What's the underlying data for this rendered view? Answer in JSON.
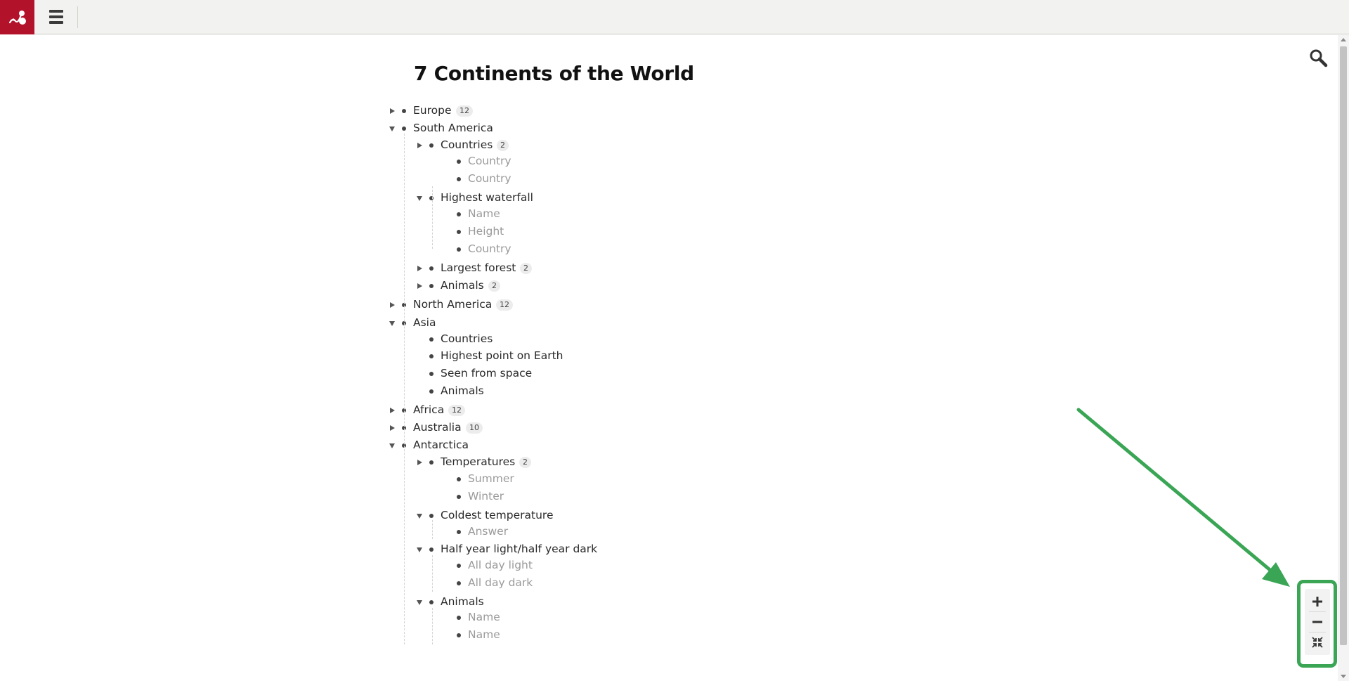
{
  "app": {
    "logo_icon": "app-logo-icon",
    "menu_icon": "hamburger-menu-icon",
    "search_icon": "search-icon"
  },
  "document": {
    "title": "7 Continents of the World"
  },
  "tree": [
    {
      "id": "europe",
      "depth": 0,
      "label": "Europe",
      "expander": "collapsed",
      "count": "12",
      "muted": false
    },
    {
      "id": "south-america",
      "depth": 0,
      "label": "South America",
      "expander": "expanded",
      "count": "",
      "muted": false
    },
    {
      "id": "sa-countries",
      "depth": 1,
      "label": "Countries",
      "expander": "collapsed",
      "count": "2",
      "muted": false
    },
    {
      "id": "sa-country-1",
      "depth": 2,
      "label": "Country",
      "expander": "none",
      "count": "",
      "muted": true
    },
    {
      "id": "sa-country-2",
      "depth": 2,
      "label": "Country",
      "expander": "none",
      "count": "",
      "muted": true
    },
    {
      "id": "sa-waterfall",
      "depth": 1,
      "label": "Highest waterfall",
      "expander": "expanded",
      "count": "",
      "muted": false
    },
    {
      "id": "sa-wf-name",
      "depth": 2,
      "label": "Name",
      "expander": "none",
      "count": "",
      "muted": true
    },
    {
      "id": "sa-wf-height",
      "depth": 2,
      "label": "Height",
      "expander": "none",
      "count": "",
      "muted": true
    },
    {
      "id": "sa-wf-country",
      "depth": 2,
      "label": "Country",
      "expander": "none",
      "count": "",
      "muted": true
    },
    {
      "id": "sa-forest",
      "depth": 1,
      "label": "Largest forest",
      "expander": "collapsed",
      "count": "2",
      "muted": false
    },
    {
      "id": "sa-animals",
      "depth": 1,
      "label": "Animals",
      "expander": "collapsed",
      "count": "2",
      "muted": false
    },
    {
      "id": "north-america",
      "depth": 0,
      "label": "North America",
      "expander": "collapsed",
      "count": "12",
      "muted": false
    },
    {
      "id": "asia",
      "depth": 0,
      "label": "Asia",
      "expander": "expanded",
      "count": "",
      "muted": false
    },
    {
      "id": "asia-countries",
      "depth": 1,
      "label": "Countries",
      "expander": "none",
      "count": "",
      "muted": false
    },
    {
      "id": "asia-highest",
      "depth": 1,
      "label": "Highest point on Earth",
      "expander": "none",
      "count": "",
      "muted": false
    },
    {
      "id": "asia-space",
      "depth": 1,
      "label": "Seen from space",
      "expander": "none",
      "count": "",
      "muted": false
    },
    {
      "id": "asia-animals",
      "depth": 1,
      "label": "Animals",
      "expander": "none",
      "count": "",
      "muted": false
    },
    {
      "id": "africa",
      "depth": 0,
      "label": "Africa",
      "expander": "collapsed",
      "count": "12",
      "muted": false
    },
    {
      "id": "australia",
      "depth": 0,
      "label": "Australia",
      "expander": "collapsed",
      "count": "10",
      "muted": false
    },
    {
      "id": "antarctica",
      "depth": 0,
      "label": "Antarctica",
      "expander": "expanded",
      "count": "",
      "muted": false
    },
    {
      "id": "ant-temps",
      "depth": 1,
      "label": "Temperatures",
      "expander": "collapsed",
      "count": "2",
      "muted": false
    },
    {
      "id": "ant-summer",
      "depth": 2,
      "label": "Summer",
      "expander": "none",
      "count": "",
      "muted": true
    },
    {
      "id": "ant-winter",
      "depth": 2,
      "label": "Winter",
      "expander": "none",
      "count": "",
      "muted": true
    },
    {
      "id": "ant-coldest",
      "depth": 1,
      "label": "Coldest temperature",
      "expander": "expanded",
      "count": "",
      "muted": false
    },
    {
      "id": "ant-answer",
      "depth": 2,
      "label": "Answer",
      "expander": "none",
      "count": "",
      "muted": true
    },
    {
      "id": "ant-halfyear",
      "depth": 1,
      "label": "Half year light/half year dark",
      "expander": "expanded",
      "count": "",
      "muted": false
    },
    {
      "id": "ant-daylight",
      "depth": 2,
      "label": "All day light",
      "expander": "none",
      "count": "",
      "muted": true
    },
    {
      "id": "ant-daydark",
      "depth": 2,
      "label": "All day dark",
      "expander": "none",
      "count": "",
      "muted": true
    },
    {
      "id": "ant-animals",
      "depth": 1,
      "label": "Animals",
      "expander": "expanded",
      "count": "",
      "muted": false
    },
    {
      "id": "ant-an-name-1",
      "depth": 2,
      "label": "Name",
      "expander": "none",
      "count": "",
      "muted": true
    },
    {
      "id": "ant-an-name-2",
      "depth": 2,
      "label": "Name",
      "expander": "none",
      "count": "",
      "muted": true
    }
  ],
  "zoom_controls": {
    "zoom_in_icon": "plus-icon",
    "zoom_out_icon": "minus-icon",
    "fit_icon": "collapse-arrows-icon",
    "highlight_color": "#3aa655"
  },
  "colors": {
    "brand": "#b3122b",
    "annotation": "#3aa655"
  }
}
